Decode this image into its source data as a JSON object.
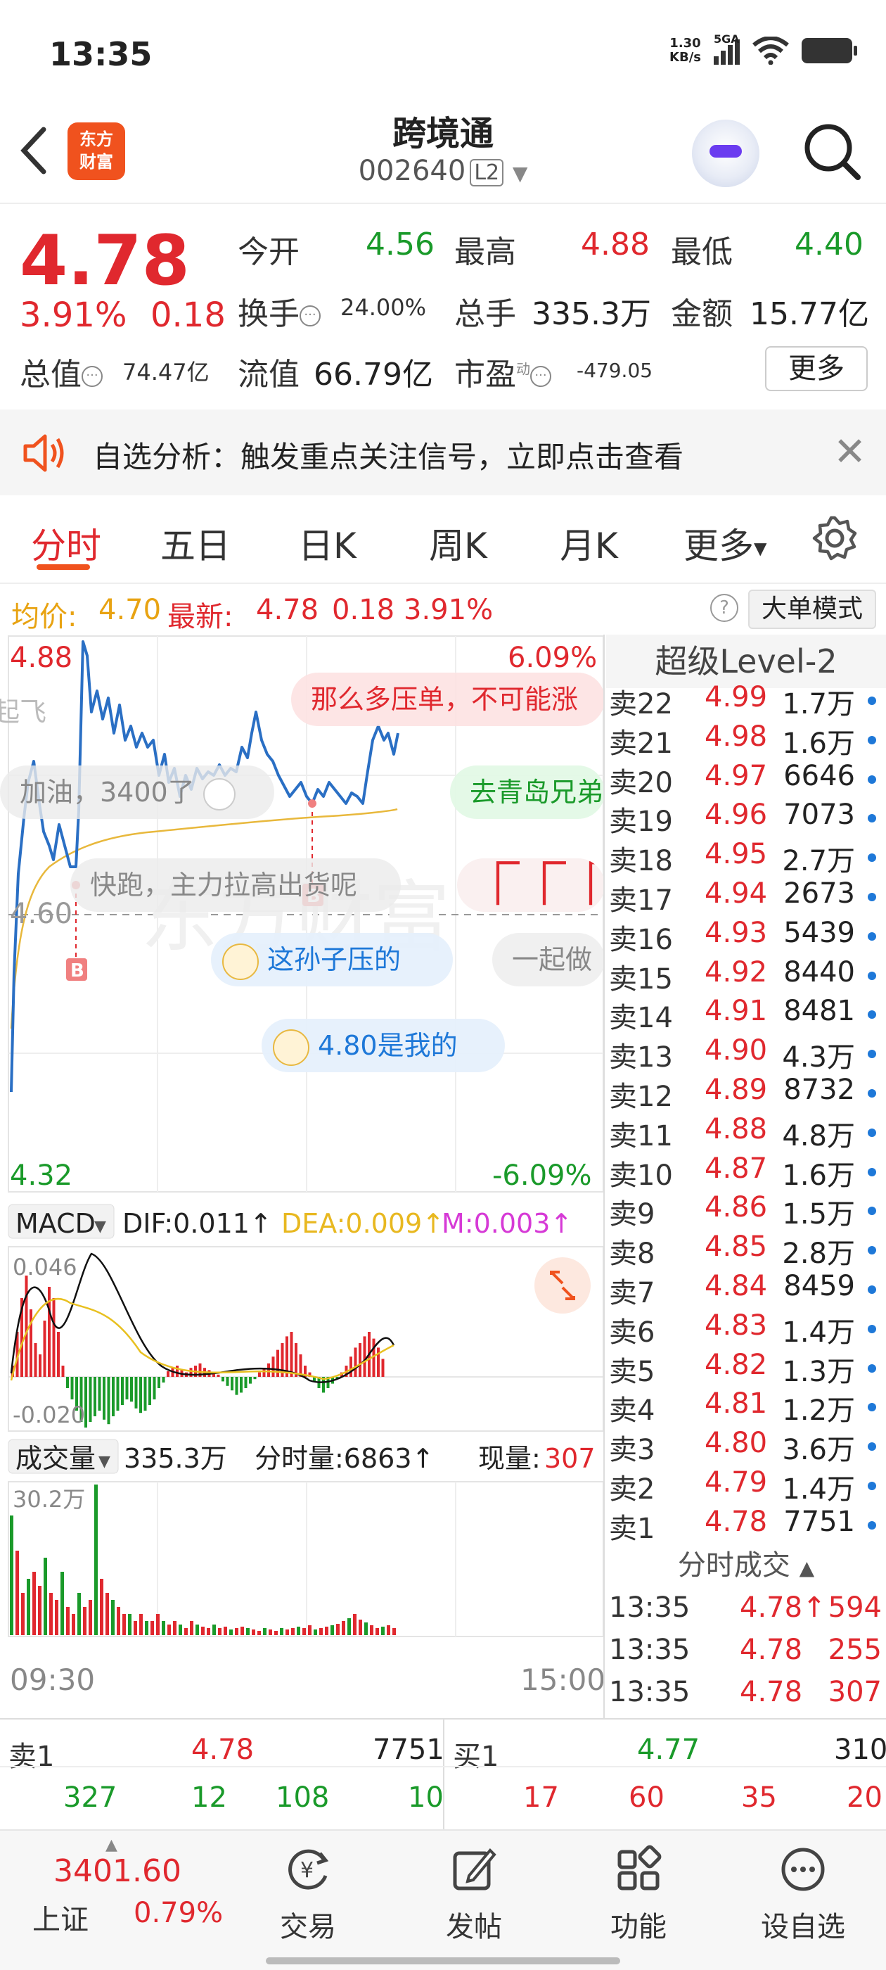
{
  "status_bar": {
    "time": "13:35",
    "net_speed": "1.30",
    "net_unit": "KB/s",
    "signal": "5GA"
  },
  "header": {
    "stock_name": "跨境通",
    "stock_code": "002640",
    "level_badge": "L2",
    "logo_text_1": "东方",
    "logo_text_2": "财富"
  },
  "quote": {
    "price": "4.78",
    "change_pct": "3.91%",
    "change": "0.18",
    "open_label": "今开",
    "open": "4.56",
    "high_label": "最高",
    "high": "4.88",
    "low_label": "最低",
    "low": "4.40",
    "turnover_label": "换手",
    "turnover": "24.00%",
    "volume_label": "总手",
    "volume": "335.3万",
    "amount_label": "金额",
    "amount": "15.77亿",
    "total_mv_label": "总值",
    "total_mv": "74.47亿",
    "float_mv_label": "流值",
    "float_mv": "66.79亿",
    "pe_label": "市盈",
    "pe_sup": "动",
    "pe": "-479.05",
    "more_label": "更多"
  },
  "notice": {
    "text": "自选分析：触发重点关注信号，立即点击查看"
  },
  "tabs": {
    "items": [
      "分时",
      "五日",
      "日K",
      "周K",
      "月K",
      "更多"
    ],
    "active": 0
  },
  "avg_line": {
    "avg_label": "均价:",
    "avg": "4.70",
    "latest_label": "最新:",
    "latest": "4.78",
    "chg": "0.18",
    "pct": "3.91%",
    "big_order_label": "大单模式"
  },
  "intraday_chart": {
    "y_top": "4.88",
    "y_bottom": "4.32",
    "y_mid": "4.60",
    "pct_top": "6.09%",
    "pct_bottom": "-6.09%",
    "time_start": "09:30",
    "time_end": "15:00",
    "marker": "B",
    "watermark": "东方财富"
  },
  "danmaku": [
    "起飞",
    "那么多压单，不可能涨",
    "加油，3400了",
    "去青岛兄弟",
    "快跑，主力拉高出货呢",
    "这孙子压的",
    "一起做",
    "4.80是我的"
  ],
  "macd": {
    "label": "MACD",
    "dif": "DIF:0.011↑",
    "dea": "DEA:0.009↑",
    "m": "M:0.003↑",
    "y_top": "0.046",
    "y_bottom": "-0.020"
  },
  "volume_panel": {
    "label": "成交量",
    "total": "335.3万",
    "minute_vol": "分时量:6863↑",
    "now_vol_label": "现量:",
    "now_vol": "307",
    "y_top": "30.2万"
  },
  "order_book": {
    "title": "超级Level-2",
    "asks": [
      {
        "label": "卖22",
        "price": "4.99",
        "qty": "1.7万"
      },
      {
        "label": "卖21",
        "price": "4.98",
        "qty": "1.6万"
      },
      {
        "label": "卖20",
        "price": "4.97",
        "qty": "6646"
      },
      {
        "label": "卖19",
        "price": "4.96",
        "qty": "7073"
      },
      {
        "label": "卖18",
        "price": "4.95",
        "qty": "2.7万"
      },
      {
        "label": "卖17",
        "price": "4.94",
        "qty": "2673"
      },
      {
        "label": "卖16",
        "price": "4.93",
        "qty": "5439"
      },
      {
        "label": "卖15",
        "price": "4.92",
        "qty": "8440"
      },
      {
        "label": "卖14",
        "price": "4.91",
        "qty": "8481"
      },
      {
        "label": "卖13",
        "price": "4.90",
        "qty": "4.3万"
      },
      {
        "label": "卖12",
        "price": "4.89",
        "qty": "8732"
      },
      {
        "label": "卖11",
        "price": "4.88",
        "qty": "4.8万"
      },
      {
        "label": "卖10",
        "price": "4.87",
        "qty": "1.6万"
      },
      {
        "label": "卖9",
        "price": "4.86",
        "qty": "1.5万"
      },
      {
        "label": "卖8",
        "price": "4.85",
        "qty": "2.8万"
      },
      {
        "label": "卖7",
        "price": "4.84",
        "qty": "8459"
      },
      {
        "label": "卖6",
        "price": "4.83",
        "qty": "1.4万"
      },
      {
        "label": "卖5",
        "price": "4.82",
        "qty": "1.3万"
      },
      {
        "label": "卖4",
        "price": "4.81",
        "qty": "1.2万"
      },
      {
        "label": "卖3",
        "price": "4.80",
        "qty": "3.6万"
      },
      {
        "label": "卖2",
        "price": "4.79",
        "qty": "1.4万"
      },
      {
        "label": "卖1",
        "price": "4.78",
        "qty": "7751"
      }
    ]
  },
  "ticks": {
    "title": "分时成交",
    "rows": [
      {
        "time": "13:35",
        "price": "4.78↑",
        "vol": "594"
      },
      {
        "time": "13:35",
        "price": "4.78",
        "vol": "255"
      },
      {
        "time": "13:35",
        "price": "4.78",
        "vol": "307"
      }
    ]
  },
  "bid_ask": {
    "sell1_label": "卖1",
    "sell1_price": "4.78",
    "sell1_qty": "7751",
    "buy1_label": "买1",
    "buy1_price": "4.77",
    "buy1_qty": "310",
    "sell_detail": [
      "327",
      "12",
      "108",
      "10"
    ],
    "buy_detail": [
      "17",
      "60",
      "35",
      "20"
    ]
  },
  "bottom_nav": {
    "index_value": "3401.60",
    "index_name": "上证",
    "index_pct": "0.79%",
    "items": [
      "交易",
      "发帖",
      "功能",
      "设自选"
    ]
  }
}
